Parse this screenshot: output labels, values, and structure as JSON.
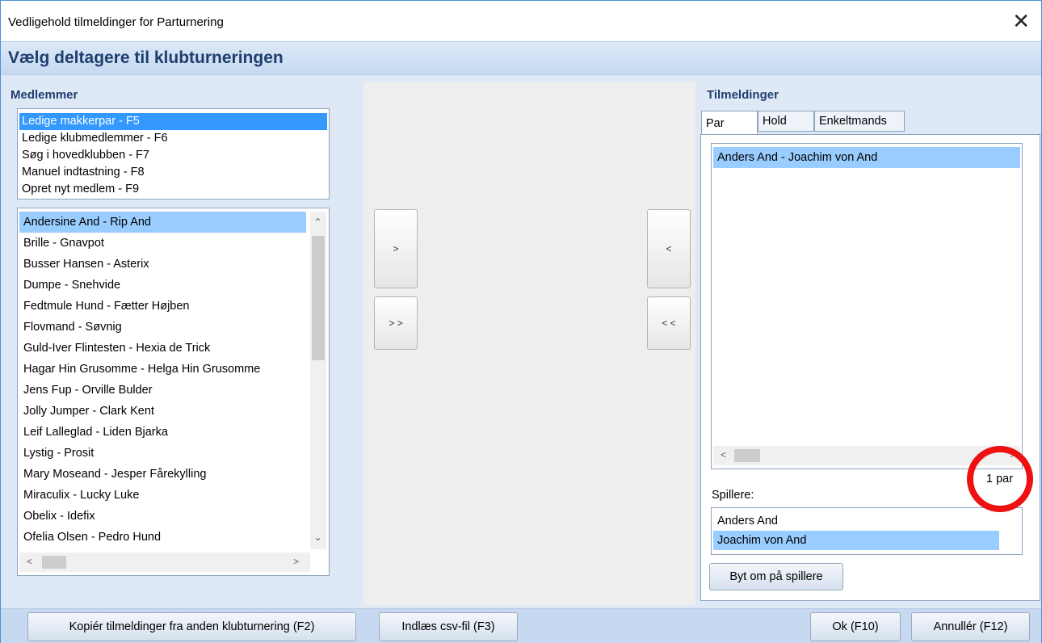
{
  "window": {
    "title": "Vedligehold tilmeldinger for Parturnering",
    "close_glyph": "✕"
  },
  "header": {
    "heading": "Vælg deltagere til klubturneringen"
  },
  "members": {
    "label": "Medlemmer",
    "sources": [
      "Ledige makkerpar - F5",
      "Ledige klubmedlemmer - F6",
      "Søg i hovedklubben - F7",
      "Manuel indtastning - F8",
      "Opret nyt medlem - F9"
    ],
    "selected_source": 0,
    "pairs": [
      "Andersine And - Rip And",
      "Brille - Gnavpot",
      "Busser Hansen - Asterix",
      "Dumpe - Snehvide",
      "Fedtmule Hund - Fætter Højben",
      "Flovmand - Søvnig",
      "Guld-Iver Flintesten - Hexia de Trick",
      "Hagar Hin Grusomme - Helga Hin Grusomme",
      "Jens Fup - Orville Bulder",
      "Jolly Jumper - Clark Kent",
      "Leif Lalleglad - Liden Bjarka",
      "Lystig - Prosit",
      "Mary Moseand - Jesper Fårekylling",
      "Miraculix - Lucky Luke",
      "Obelix - Idefix",
      "Ofelia Olsen - Pedro Hund"
    ],
    "highlighted_pair": 0
  },
  "transfer": {
    "add_one": ">",
    "add_all": "> >",
    "remove_one": "<",
    "remove_all": "< <"
  },
  "registrations": {
    "label": "Tilmeldinger",
    "tabs": [
      "Par",
      "Hold",
      "Enkeltmands"
    ],
    "active_tab": 0,
    "entries": [
      "Anders And - Joachim von And"
    ],
    "count_text": "1 par",
    "players_label": "Spillere:",
    "players": [
      "Anders And",
      "Joachim von And"
    ],
    "swap_button": "Byt om på spillere"
  },
  "footer": {
    "copy_button": "Kopiér tilmeldinger fra anden klubturnering (F2)",
    "csv_button": "Indlæs csv-fil (F3)",
    "ok_button": "Ok (F10)",
    "cancel_button": "Annullér (F12)"
  },
  "annotation": {
    "color": "#ee1111"
  },
  "colors": {
    "selection": "#3399ff",
    "highlight": "#99ccff",
    "heading": "#1e3f6e"
  }
}
